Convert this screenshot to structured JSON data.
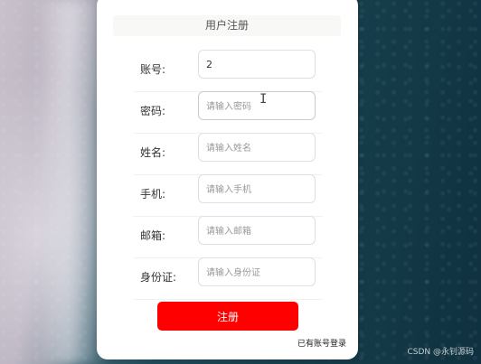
{
  "form": {
    "title": "用户注册",
    "fields": [
      {
        "label": "账号:",
        "value": "2",
        "placeholder": ""
      },
      {
        "label": "密码:",
        "value": "",
        "placeholder": "请输入密码"
      },
      {
        "label": "姓名:",
        "value": "",
        "placeholder": "请输入姓名"
      },
      {
        "label": "手机:",
        "value": "",
        "placeholder": "请输入手机"
      },
      {
        "label": "邮箱:",
        "value": "",
        "placeholder": "请输入邮箱"
      },
      {
        "label": "身份证:",
        "value": "",
        "placeholder": "请输入身份证"
      }
    ],
    "submit_label": "注册",
    "login_link": "已有账号登录"
  },
  "cursor": "I",
  "watermark": "CSDN @永钊源码",
  "colors": {
    "primary_button": "#ff0000",
    "card_bg": "#ffffff"
  }
}
